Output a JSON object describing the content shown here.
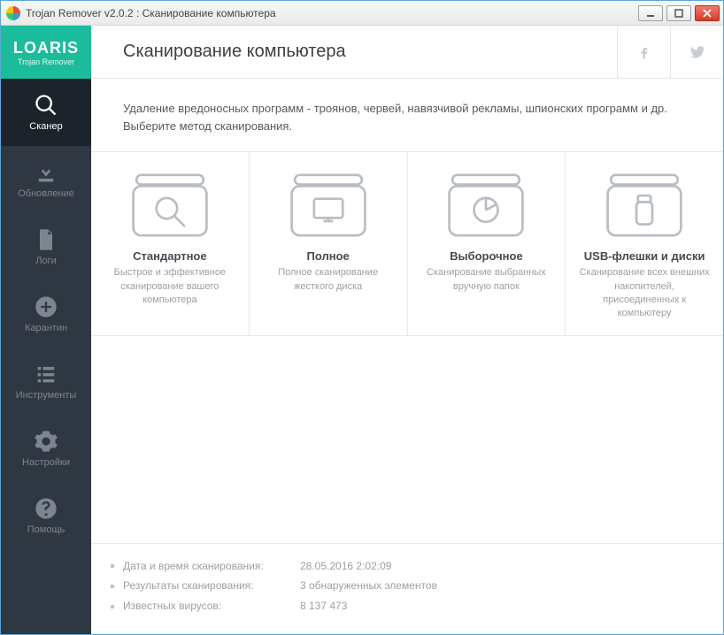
{
  "window": {
    "title": "Trojan Remover v2.0.2 : Сканирование компьютера"
  },
  "logo": {
    "brand": "LOARIS",
    "sub": "Trojan Remover"
  },
  "nav": [
    {
      "id": "scan",
      "label": "Сканер",
      "icon": "search",
      "active": true
    },
    {
      "id": "update",
      "label": "Обновление",
      "icon": "download",
      "active": false
    },
    {
      "id": "logs",
      "label": "Логи",
      "icon": "file",
      "active": false
    },
    {
      "id": "quarantine",
      "label": "Карантин",
      "icon": "plus-circle",
      "active": false
    },
    {
      "id": "tools",
      "label": "Инструменты",
      "icon": "list",
      "active": false
    },
    {
      "id": "settings",
      "label": "Настройки",
      "icon": "gear",
      "active": false
    },
    {
      "id": "help",
      "label": "Помощь",
      "icon": "help",
      "active": false
    }
  ],
  "header": {
    "title": "Сканирование компьютера"
  },
  "description": {
    "line1": "Удаление вредоносных программ - троянов, червей, навязчивой рекламы, шпионских программ и др.",
    "line2": "Выберите метод сканирования."
  },
  "scan_options": [
    {
      "id": "standard",
      "title": "Стандартное",
      "desc": "Быстрое и эффективное сканирование вашего компьютера",
      "icon": "box-search"
    },
    {
      "id": "full",
      "title": "Полное",
      "desc": "Полное сканирование жесткого диска",
      "icon": "box-monitor"
    },
    {
      "id": "custom",
      "title": "Выборочное",
      "desc": "Сканирование выбранных вручную папок",
      "icon": "box-pie"
    },
    {
      "id": "usb",
      "title": "USB-флешки и диски",
      "desc": "Сканирование всех внешних накопителей, присоединенных к компьютеру",
      "icon": "box-usb"
    }
  ],
  "stats": [
    {
      "label": "Дата и время сканирования:",
      "value": "28.05.2016 2:02:09"
    },
    {
      "label": "Результаты сканирования:",
      "value": "3 обнаруженных элементов"
    },
    {
      "label": "Известных вирусов:",
      "value": "8 137 473"
    }
  ]
}
